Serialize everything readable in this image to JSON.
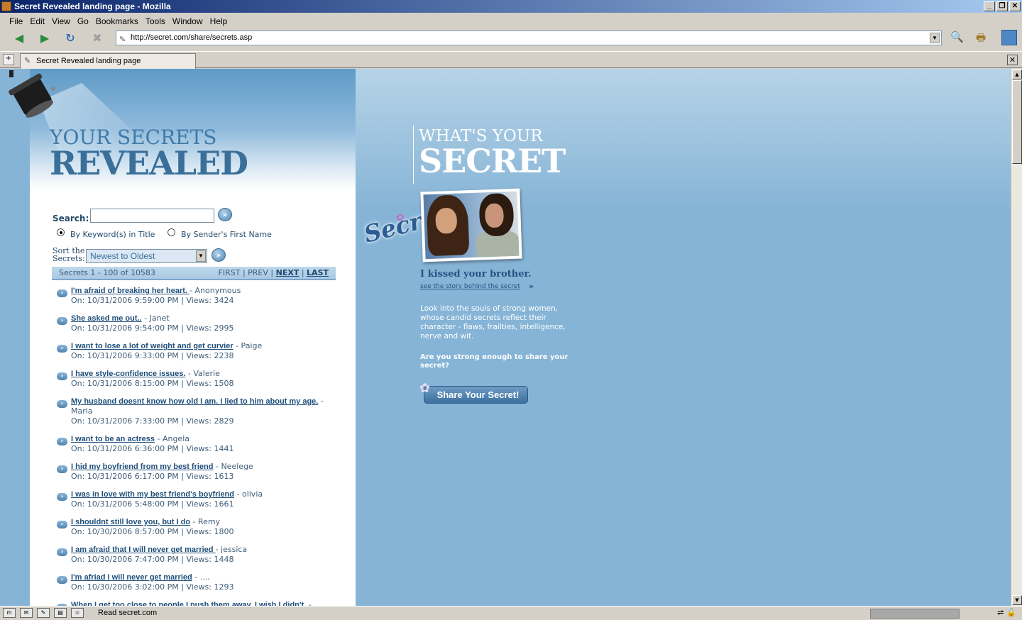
{
  "window": {
    "title": "Secret Revealed landing page - Mozilla",
    "url": "http://secret.com/share/secrets.asp",
    "tab_label": "Secret Revealed landing page",
    "status_text": "Read secret.com"
  },
  "menu": [
    "File",
    "Edit",
    "View",
    "Go",
    "Bookmarks",
    "Tools",
    "Window",
    "Help"
  ],
  "left": {
    "hero_line1": "YOUR SECRETS",
    "hero_line2": "REVEALED",
    "search_label": "Search:",
    "search_value": "",
    "radio_keyword": "By Keyword(s) in Title",
    "radio_sender": "By Sender's First Name",
    "sort_label_1": "Sort the",
    "sort_label_2": "Secrets:",
    "sort_selected": "Newest to Oldest",
    "pager_count": "Secrets 1 - 100 of 10583",
    "pager_first": "FIRST",
    "pager_prev": "PREV",
    "pager_next": "NEXT",
    "pager_last": "LAST"
  },
  "secrets": [
    {
      "title": "I'm afraid of breaking her heart. ",
      "sender": " - Anonymous",
      "meta": "On: 10/31/2006 9:59:00 PM | Views: 3424"
    },
    {
      "title": "She asked me out..",
      "sender": " - Janet",
      "meta": "On: 10/31/2006 9:54:00 PM | Views: 2995"
    },
    {
      "title": "I want to lose a lot of weight and get curvier",
      "sender": " - Paige",
      "meta": "On: 10/31/2006 9:33:00 PM | Views: 2238"
    },
    {
      "title": "I have style-confidence issues.",
      "sender": " - Valerie",
      "meta": "On: 10/31/2006 8:15:00 PM | Views: 1508"
    },
    {
      "title": "My husband doesnt know how old I am. I lied to him about my age.",
      "sender": " - Maria",
      "meta": "On: 10/31/2006 7:33:00 PM | Views: 2829"
    },
    {
      "title": "I want to be an actress",
      "sender": " - Angela",
      "meta": "On: 10/31/2006 6:36:00 PM | Views: 1441"
    },
    {
      "title": "I hid my boyfriend from my best friend",
      "sender": " - Neelege",
      "meta": "On: 10/31/2006 6:17:00 PM | Views: 1613"
    },
    {
      "title": "i was in love with my best friend's boyfriend",
      "sender": " - olivia",
      "meta": "On: 10/31/2006 5:48:00 PM | Views: 1661"
    },
    {
      "title": "I shouldnt still love you, but I do",
      "sender": " - Remy",
      "meta": "On: 10/30/2006 8:57:00 PM | Views: 1800"
    },
    {
      "title": "I am afraid that I will never get married ",
      "sender": " - jessica",
      "meta": "On: 10/30/2006 7:47:00 PM | Views: 1448"
    },
    {
      "title": "I'm afriad I will never get married",
      "sender": " - ....",
      "meta": "On: 10/30/2006 3:02:00 PM | Views: 1293"
    },
    {
      "title": "When I get too close to people I push them away. I wish I didn't.",
      "sender": " -",
      "meta": ""
    }
  ],
  "right": {
    "logo_text": "Secret",
    "heading1": "WHAT'S YOUR",
    "heading2": "SECRET",
    "featured_title": "I kissed your brother.",
    "story_link": "see the story behind the secret",
    "story_arrow": "»",
    "description": "Look into the souls of strong women, whose candid secrets reflect their character - flaws, frailties, intelligence, nerve and wit.",
    "question": "Are you strong enough to share your secret?",
    "share_button": "Share Your Secret!"
  }
}
